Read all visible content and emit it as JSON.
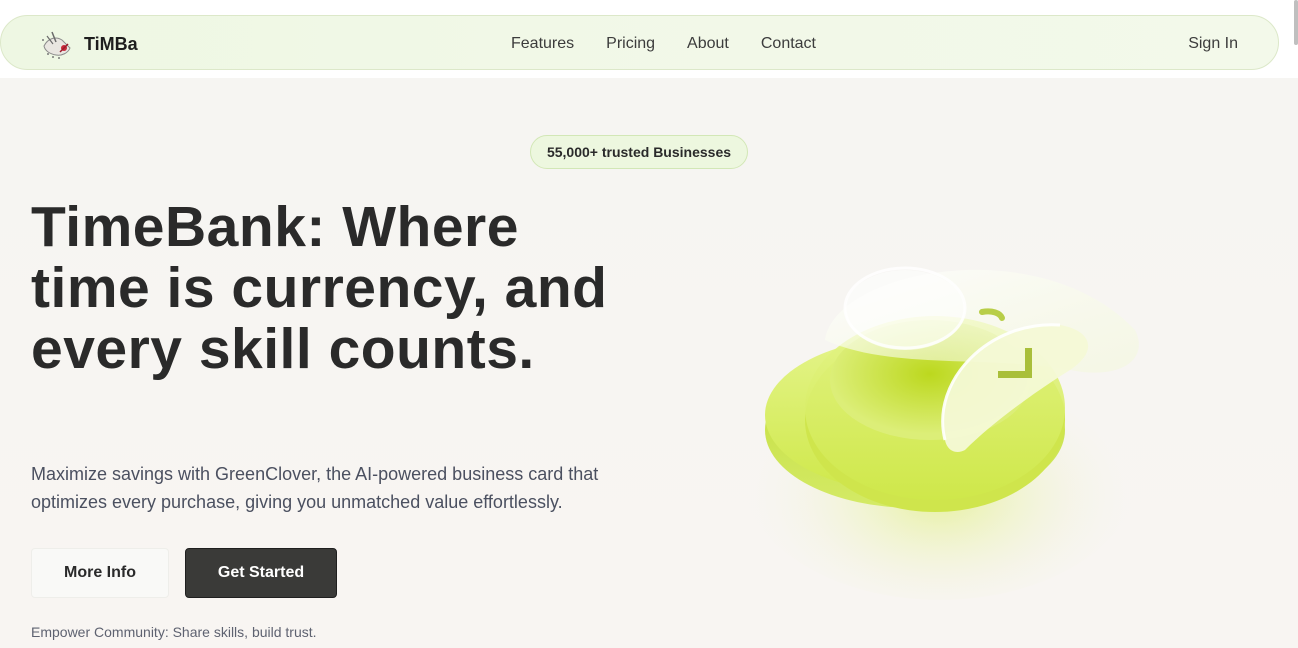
{
  "brand": {
    "name": "TiMBa",
    "logo_icon": "timebank-logo-icon"
  },
  "nav": {
    "links": [
      {
        "label": "Features"
      },
      {
        "label": "Pricing"
      },
      {
        "label": "About"
      },
      {
        "label": "Contact"
      }
    ],
    "sign_in": "Sign In"
  },
  "badge": {
    "text": "55,000+ trusted Businesses"
  },
  "hero": {
    "title": "TimeBank: Where time is currency, and every skill counts.",
    "subtitle": "Maximize savings with GreenClover, the AI-powered business card that optimizes every purchase, giving you unmatched value effortlessly.",
    "buttons": {
      "more_info": "More Info",
      "get_started": "Get Started"
    },
    "tagline": "Empower Community: Share skills, build trust.",
    "illustration_icon": "glass-coin-clock-icon"
  },
  "colors": {
    "accent_lime": "#c6e33a",
    "badge_bg": "#edf7df",
    "dark_button": "#3a3a38",
    "text_dark": "#2a2a2a"
  }
}
